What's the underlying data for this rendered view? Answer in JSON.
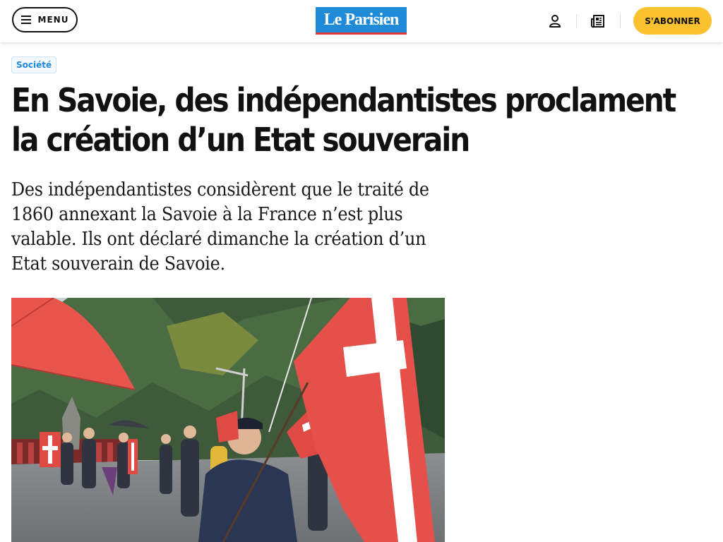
{
  "header": {
    "menu_label": "MENU",
    "logo_text": "Le Parisien",
    "subscribe_label": "S'ABONNER",
    "brand_blue": "#1f8ad8",
    "brand_red": "#e23b3b",
    "subscribe_color": "#f9c22e"
  },
  "article": {
    "category": "Société",
    "title": "En Savoie, des indépendantistes proclament la création d’un Etat souverain",
    "lead": "Des indépendantistes considèrent que le traité de 1860 annexant la Savoie à la France n’est plus valable. Ils ont déclaré dimanche la création d’un Etat souverain de Savoie."
  },
  "icons": {
    "menu": "hamburger-icon",
    "account": "user-icon",
    "journal": "newspaper-icon"
  }
}
